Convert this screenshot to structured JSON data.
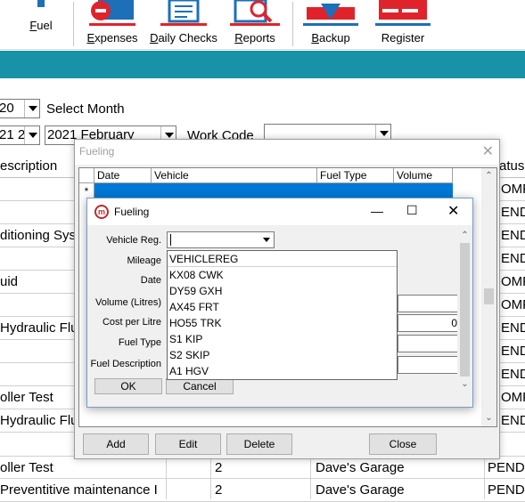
{
  "toolbar": {
    "items": [
      {
        "label": "Fuel",
        "underline": "F",
        "rest": "uel"
      },
      {
        "label": "Expenses",
        "underline": "E",
        "rest": "xpenses"
      },
      {
        "label": "Daily Checks",
        "underline": "D",
        "rest": "aily Checks"
      },
      {
        "label": "Reports",
        "underline": "R",
        "rest": "eports"
      },
      {
        "label": "Backup",
        "underline": "B",
        "rest": "ackup"
      },
      {
        "label": "Register",
        "underline": "",
        "rest": "Register"
      }
    ]
  },
  "filters": {
    "year_value": "20",
    "select_month_label": "Select Month",
    "month_prefix": "21 2.",
    "month_value": "2021 February",
    "work_code_label": "Work Code",
    "work_code_value": ""
  },
  "bg_grid": {
    "col_description": "escription",
    "col_status": "atus",
    "rows": [
      {
        "desc": "",
        "num": "",
        "garage": "",
        "status": "OMP"
      },
      {
        "desc": "",
        "num": "",
        "garage": "",
        "status": "ENDI"
      },
      {
        "desc": "ditioning Sys",
        "num": "",
        "garage": "",
        "status": "ENDI"
      },
      {
        "desc": "",
        "num": "",
        "garage": "",
        "status": "ENDI"
      },
      {
        "desc": "uid",
        "num": "",
        "garage": "",
        "status": "OMP"
      },
      {
        "desc": "",
        "num": "",
        "garage": "",
        "status": "OMP"
      },
      {
        "desc": "Hydraulic Flu",
        "num": "",
        "garage": "",
        "status": "ENDI"
      },
      {
        "desc": "",
        "num": "",
        "garage": "",
        "status": "ENDI"
      },
      {
        "desc": "",
        "num": "",
        "garage": "",
        "status": "ENDI"
      },
      {
        "desc": "oller Test",
        "num": "",
        "garage": "",
        "status": "OMP"
      },
      {
        "desc": "Hydraulic Flu",
        "num": "",
        "garage": "",
        "status": "ENDI"
      },
      {
        "desc": "oller Test",
        "num": "2",
        "garage": "Dave's Garage",
        "status": "PENDI"
      },
      {
        "desc": " Preventitive maintenance I",
        "num": "2",
        "garage": "Dave's Garage",
        "status": "PENDI"
      }
    ]
  },
  "outer_dialog": {
    "title": "Fueling",
    "close_glyph": "✕",
    "columns": [
      "Date",
      "Vehicle",
      "Fuel Type",
      "Volume"
    ],
    "new_row_marker": "*",
    "buttons": {
      "add": "Add",
      "edit": "Edit",
      "delete": "Delete",
      "close": "Close"
    }
  },
  "inner_dialog": {
    "title": "Fueling",
    "logo_letter": "m",
    "fields": {
      "vehicle_reg": "Vehicle Reg.",
      "mileage": "Mileage",
      "date": "Date",
      "volume": "Volume (Litres)",
      "cost": "Cost per Litre",
      "fuel_type": "Fuel Type",
      "fuel_description": "Fuel Description"
    },
    "cost_value_fragment": "0",
    "buttons": {
      "ok": "OK",
      "cancel": "Cancel"
    },
    "vehicle_options": [
      "VEHICLEREG",
      "KX08 CWK",
      "DY59 GXH",
      "AX45 FRT",
      "HO55 TRK",
      "S1 KIP",
      "S2 SKIP",
      "A1 HGV"
    ]
  },
  "colors": {
    "accent_band": "#1792a6",
    "selection": "#0078d7",
    "icon_red": "#e0232b",
    "icon_blue": "#1d6fb8"
  }
}
